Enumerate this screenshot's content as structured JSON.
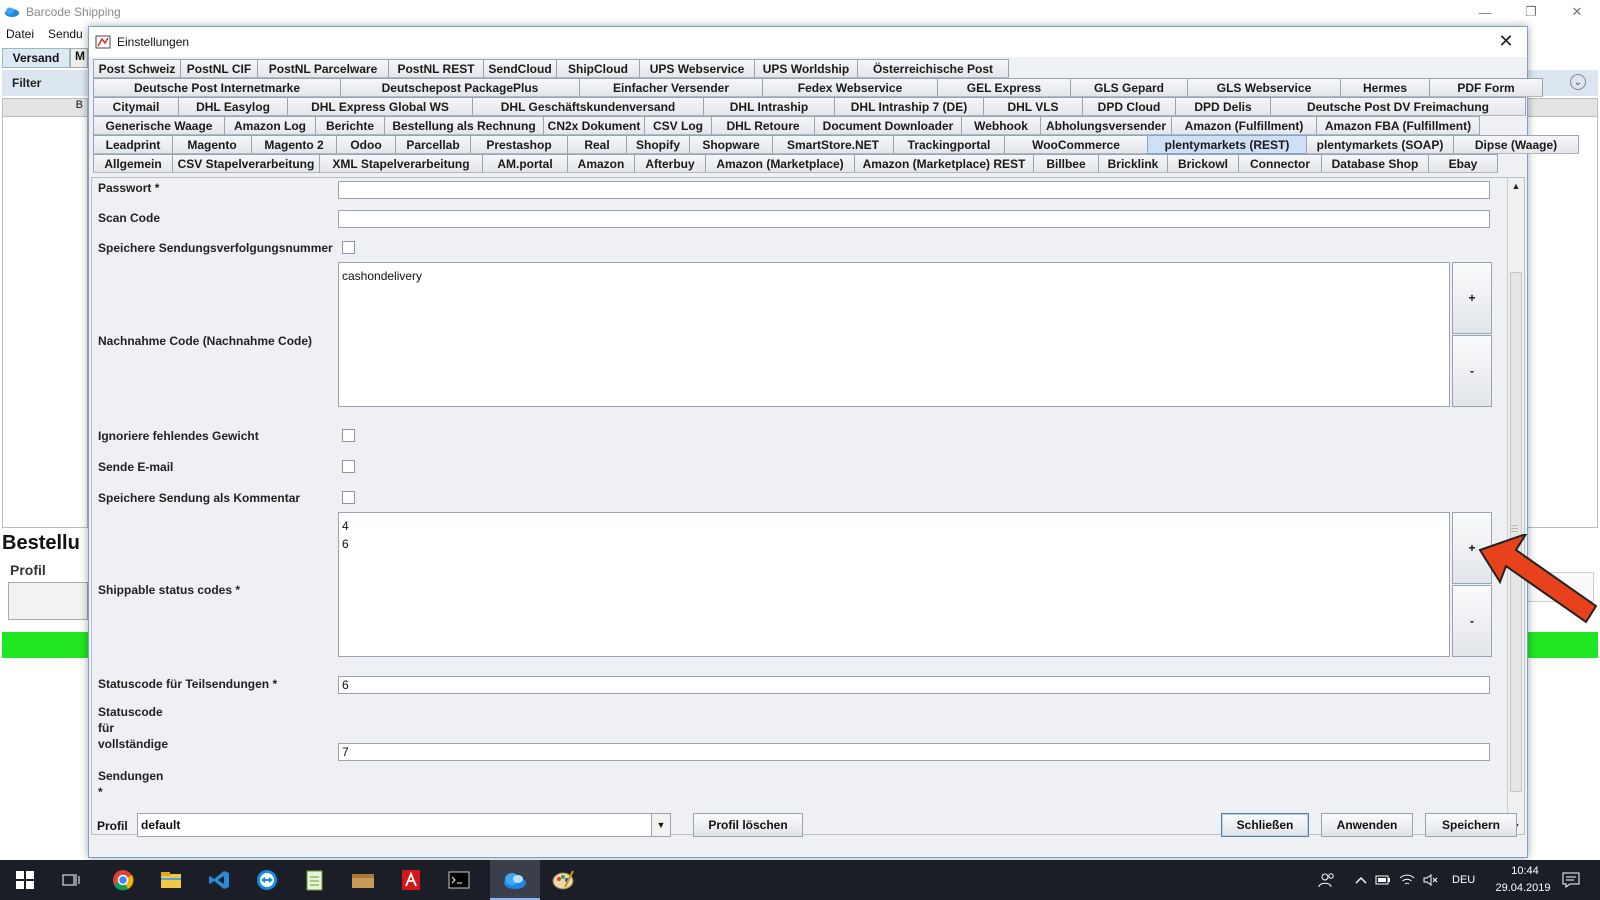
{
  "app": {
    "title": "Barcode Shipping",
    "menu": [
      "Datei",
      "Sendu"
    ],
    "tab_versand": "Versand",
    "tab_m": "M",
    "filter_label": "Filter",
    "bestell_label": "Bestellu",
    "profil_label": "Profil",
    "panel_header_letter": "B"
  },
  "dialog": {
    "title": "Einstellungen",
    "tab_rows": [
      [
        "Post Schweiz",
        "PostNL CIF",
        "PostNL Parcelware",
        "PostNL REST",
        "SendCloud",
        "ShipCloud",
        "UPS Webservice",
        "UPS Worldship",
        "Österreichische Post"
      ],
      [
        "Deutsche Post Internetmarke",
        "Deutschepost PackagePlus",
        "Einfacher Versender",
        "Fedex Webservice",
        "GEL Express",
        "GLS Gepard",
        "GLS Webservice",
        "Hermes",
        "PDF Form"
      ],
      [
        "Citymail",
        "DHL Easylog",
        "DHL Express Global WS",
        "DHL Geschäftskundenversand",
        "DHL Intraship",
        "DHL Intraship 7 (DE)",
        "DHL VLS",
        "DPD Cloud",
        "DPD Delis",
        "Deutsche Post DV Freimachung"
      ],
      [
        "Generische Waage",
        "Amazon Log",
        "Berichte",
        "Bestellung als Rechnung",
        "CN2x Dokument",
        "CSV Log",
        "DHL Retoure",
        "Document Downloader",
        "Webhook",
        "Abholungsversender",
        "Amazon (Fulfillment)",
        "Amazon FBA (Fulfillment)"
      ],
      [
        "Leadprint",
        "Magento",
        "Magento 2",
        "Odoo",
        "Parcellab",
        "Prestashop",
        "Real",
        "Shopify",
        "Shopware",
        "SmartStore.NET",
        "Trackingportal",
        "WooCommerce",
        "plentymarkets (REST)",
        "plentymarkets (SOAP)",
        "Dipse (Waage)"
      ],
      [
        "Allgemein",
        "CSV Stapelverarbeitung",
        "XML Stapelverarbeitung",
        "AM.portal",
        "Amazon",
        "Afterbuy",
        "Amazon (Marketplace)",
        "Amazon (Marketplace) REST",
        "Billbee",
        "Bricklink",
        "Brickowl",
        "Connector",
        "Database Shop",
        "Ebay"
      ]
    ],
    "active_tab": "plentymarkets (REST)",
    "fields": {
      "passwort_label": "Passwort *",
      "passwort_value": "",
      "scan_label": "Scan Code",
      "scan_value": "",
      "speichere_svn_label": "Speichere Sendungsverfolgungsnummer",
      "nachnahme_label": "Nachnahme Code (Nachnahme Code)",
      "nachnahme_value": "cashondelivery",
      "ignoriere_label": "Ignoriere fehlendes Gewicht",
      "sende_label": "Sende E-mail",
      "kommentar_label": "Speichere Sendung als Kommentar",
      "shippable_label": "Shippable status codes *",
      "shippable_values": [
        "4",
        "6"
      ],
      "teil_label": "Statuscode für Teilsendungen *",
      "teil_value": "6",
      "voll_label_lines": [
        "Statuscode",
        "für",
        "vollständige",
        "",
        "Sendungen",
        "*"
      ],
      "voll_value": "7",
      "plus": "+",
      "minus": "-"
    },
    "bottom": {
      "profil_label": "Profil",
      "profil_value": "default",
      "delete_btn": "Profil löschen",
      "close_btn": "Schließen",
      "apply_btn": "Anwenden",
      "save_btn": "Speichern"
    }
  },
  "taskbar": {
    "lang": "DEU",
    "time": "10:44",
    "date": "29.04.2019"
  },
  "colors": {
    "accent_green": "#21e621",
    "active_tab": "#cfe0f5",
    "arrow": "#e8421c",
    "taskbar": "#1b1e27"
  }
}
